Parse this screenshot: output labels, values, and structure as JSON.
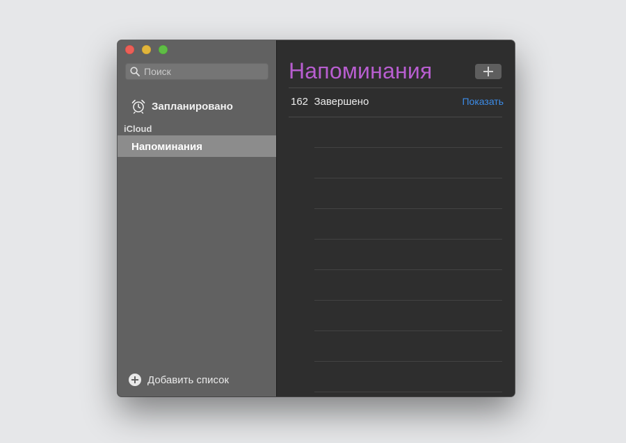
{
  "window": {
    "controls": [
      "close",
      "minimize",
      "zoom"
    ]
  },
  "sidebar": {
    "search": {
      "placeholder": "Поиск",
      "value": ""
    },
    "smart_list": {
      "label": "Запланировано",
      "icon": "alarm-clock-icon"
    },
    "account_section": "iCloud",
    "lists": [
      {
        "label": "Напоминания",
        "selected": true
      }
    ],
    "add_list_label": "Добавить список"
  },
  "main": {
    "title": "Напоминания",
    "title_color": "#b85ed0",
    "completed_count": "162",
    "completed_label": "Завершено",
    "show_label": "Показать",
    "link_color": "#3c8ce8",
    "add_button_icon": "plus-icon"
  }
}
